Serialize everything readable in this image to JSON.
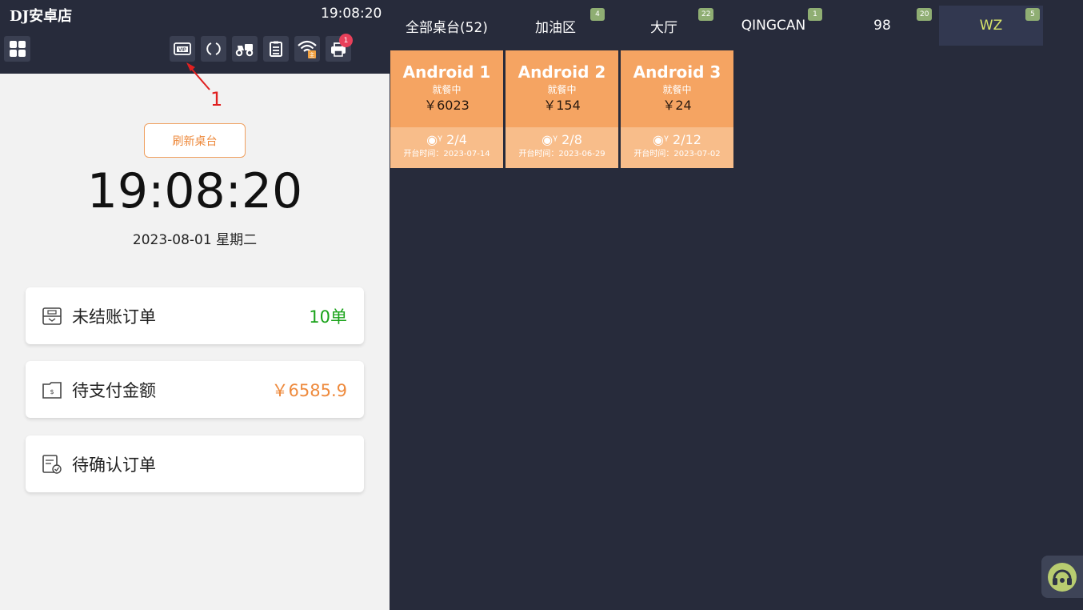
{
  "store_name": "DJ安卓店",
  "header_time": "19:08:20",
  "annotation_number": "1",
  "refresh_label": "刷新桌台",
  "clock": "19:08:20",
  "date_line": "2023-08-01 星期二",
  "printer_badge": "1",
  "icons": [
    "grid-icon",
    "vip-icon",
    "refresh-circle-icon",
    "delivery-icon",
    "clipboard-icon",
    "wifi-icon",
    "printer-icon",
    "headset-icon"
  ],
  "cards": [
    {
      "label": "未结账订单",
      "value": "10单",
      "value_color": "#1aa31a"
    },
    {
      "label": "待支付金额",
      "value": "￥6585.9",
      "value_color": "#ee8a3d"
    },
    {
      "label": "待确认订单",
      "value": ""
    }
  ],
  "tabs": [
    {
      "label": "全部桌台(52)",
      "badge": ""
    },
    {
      "label": "加油区",
      "badge": "4"
    },
    {
      "label": "大厅",
      "badge": "22"
    },
    {
      "label": "QINGCAN",
      "badge": "1"
    },
    {
      "label": "98",
      "badge": "20"
    },
    {
      "label": "WZ",
      "badge": "5",
      "active": true
    }
  ],
  "tables": [
    {
      "name": "Android 1",
      "status": "就餐中",
      "price": "￥6023",
      "seats": "2/4",
      "open_time": "开台时间：2023-07-14"
    },
    {
      "name": "Android 2",
      "status": "就餐中",
      "price": "￥154",
      "seats": "2/8",
      "open_time": "开台时间：2023-06-29"
    },
    {
      "name": "Android 3",
      "status": "就餐中",
      "price": "￥24",
      "seats": "2/12",
      "open_time": "开台时间：2023-07-02"
    }
  ],
  "colors": {
    "dark_bg": "#272b3b",
    "table_orange": "#f5a462",
    "table_light": "#f8bd8a",
    "active_tab_text": "#d8e46a"
  }
}
